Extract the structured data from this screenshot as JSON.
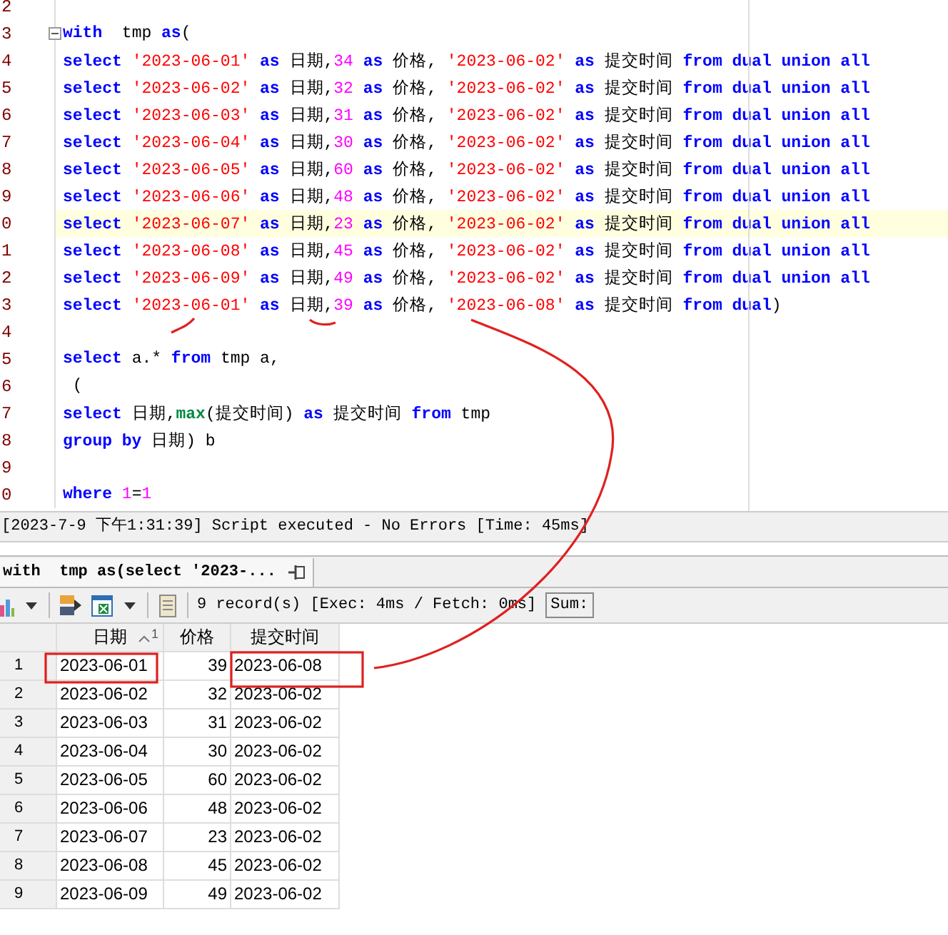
{
  "editor": {
    "lines": [
      {
        "number": "2",
        "current": false,
        "fold": false
      },
      {
        "number": "3",
        "current": false,
        "fold": true,
        "tokens": [
          {
            "kind": "kw",
            "text": "with"
          },
          {
            "kind": "t",
            "text": "  tmp "
          },
          {
            "kind": "kw",
            "text": "as"
          },
          {
            "kind": "t",
            "text": "("
          }
        ]
      },
      {
        "number": "4",
        "current": false,
        "fold": false,
        "tokens": [
          {
            "kind": "kw",
            "text": "select "
          },
          {
            "kind": "str",
            "text": "'2023-06-01' "
          },
          {
            "kind": "kw",
            "text": "as "
          },
          {
            "kind": "t",
            "text": "日期,"
          },
          {
            "kind": "num",
            "text": "34 "
          },
          {
            "kind": "kw",
            "text": "as "
          },
          {
            "kind": "t",
            "text": "价格, "
          },
          {
            "kind": "str",
            "text": "'2023-06-02' "
          },
          {
            "kind": "kw",
            "text": "as "
          },
          {
            "kind": "t",
            "text": "提交时间 "
          },
          {
            "kind": "kw",
            "text": "from dual union all"
          }
        ]
      },
      {
        "number": "5",
        "current": false,
        "fold": false,
        "tokens": [
          {
            "kind": "kw",
            "text": "select "
          },
          {
            "kind": "str",
            "text": "'2023-06-02' "
          },
          {
            "kind": "kw",
            "text": "as "
          },
          {
            "kind": "t",
            "text": "日期,"
          },
          {
            "kind": "num",
            "text": "32 "
          },
          {
            "kind": "kw",
            "text": "as "
          },
          {
            "kind": "t",
            "text": "价格, "
          },
          {
            "kind": "str",
            "text": "'2023-06-02' "
          },
          {
            "kind": "kw",
            "text": "as "
          },
          {
            "kind": "t",
            "text": "提交时间 "
          },
          {
            "kind": "kw",
            "text": "from dual union all"
          }
        ]
      },
      {
        "number": "6",
        "current": false,
        "fold": false,
        "tokens": [
          {
            "kind": "kw",
            "text": "select "
          },
          {
            "kind": "str",
            "text": "'2023-06-03' "
          },
          {
            "kind": "kw",
            "text": "as "
          },
          {
            "kind": "t",
            "text": "日期,"
          },
          {
            "kind": "num",
            "text": "31 "
          },
          {
            "kind": "kw",
            "text": "as "
          },
          {
            "kind": "t",
            "text": "价格, "
          },
          {
            "kind": "str",
            "text": "'2023-06-02' "
          },
          {
            "kind": "kw",
            "text": "as "
          },
          {
            "kind": "t",
            "text": "提交时间 "
          },
          {
            "kind": "kw",
            "text": "from dual union all"
          }
        ]
      },
      {
        "number": "7",
        "current": false,
        "fold": false,
        "tokens": [
          {
            "kind": "kw",
            "text": "select "
          },
          {
            "kind": "str",
            "text": "'2023-06-04' "
          },
          {
            "kind": "kw",
            "text": "as "
          },
          {
            "kind": "t",
            "text": "日期,"
          },
          {
            "kind": "num",
            "text": "30 "
          },
          {
            "kind": "kw",
            "text": "as "
          },
          {
            "kind": "t",
            "text": "价格, "
          },
          {
            "kind": "str",
            "text": "'2023-06-02' "
          },
          {
            "kind": "kw",
            "text": "as "
          },
          {
            "kind": "t",
            "text": "提交时间 "
          },
          {
            "kind": "kw",
            "text": "from dual union all"
          }
        ]
      },
      {
        "number": "8",
        "current": false,
        "fold": false,
        "tokens": [
          {
            "kind": "kw",
            "text": "select "
          },
          {
            "kind": "str",
            "text": "'2023-06-05' "
          },
          {
            "kind": "kw",
            "text": "as "
          },
          {
            "kind": "t",
            "text": "日期,"
          },
          {
            "kind": "num",
            "text": "60 "
          },
          {
            "kind": "kw",
            "text": "as "
          },
          {
            "kind": "t",
            "text": "价格, "
          },
          {
            "kind": "str",
            "text": "'2023-06-02' "
          },
          {
            "kind": "kw",
            "text": "as "
          },
          {
            "kind": "t",
            "text": "提交时间 "
          },
          {
            "kind": "kw",
            "text": "from dual union all"
          }
        ]
      },
      {
        "number": "9",
        "current": false,
        "fold": false,
        "tokens": [
          {
            "kind": "kw",
            "text": "select "
          },
          {
            "kind": "str",
            "text": "'2023-06-06' "
          },
          {
            "kind": "kw",
            "text": "as "
          },
          {
            "kind": "t",
            "text": "日期,"
          },
          {
            "kind": "num",
            "text": "48 "
          },
          {
            "kind": "kw",
            "text": "as "
          },
          {
            "kind": "t",
            "text": "价格, "
          },
          {
            "kind": "str",
            "text": "'2023-06-02' "
          },
          {
            "kind": "kw",
            "text": "as "
          },
          {
            "kind": "t",
            "text": "提交时间 "
          },
          {
            "kind": "kw",
            "text": "from dual union all"
          }
        ]
      },
      {
        "number": "0",
        "current": true,
        "fold": false,
        "tokens": [
          {
            "kind": "kw",
            "text": "select "
          },
          {
            "kind": "str",
            "text": "'2023-06-07' "
          },
          {
            "kind": "kw",
            "text": "as "
          },
          {
            "kind": "t",
            "text": "日期,"
          },
          {
            "kind": "num",
            "text": "23 "
          },
          {
            "kind": "kw",
            "text": "as "
          },
          {
            "kind": "t",
            "text": "价格, "
          },
          {
            "kind": "str",
            "text": "'2023-06-02' "
          },
          {
            "kind": "kw",
            "text": "as "
          },
          {
            "kind": "t",
            "text": "提交时间 "
          },
          {
            "kind": "kw",
            "text": "from dual union all"
          }
        ]
      },
      {
        "number": "1",
        "current": false,
        "fold": false,
        "tokens": [
          {
            "kind": "kw",
            "text": "select "
          },
          {
            "kind": "str",
            "text": "'2023-06-08' "
          },
          {
            "kind": "kw",
            "text": "as "
          },
          {
            "kind": "t",
            "text": "日期,"
          },
          {
            "kind": "num",
            "text": "45 "
          },
          {
            "kind": "kw",
            "text": "as "
          },
          {
            "kind": "t",
            "text": "价格, "
          },
          {
            "kind": "str",
            "text": "'2023-06-02' "
          },
          {
            "kind": "kw",
            "text": "as "
          },
          {
            "kind": "t",
            "text": "提交时间 "
          },
          {
            "kind": "kw",
            "text": "from dual union all"
          }
        ]
      },
      {
        "number": "2",
        "current": false,
        "fold": false,
        "tokens": [
          {
            "kind": "kw",
            "text": "select "
          },
          {
            "kind": "str",
            "text": "'2023-06-09' "
          },
          {
            "kind": "kw",
            "text": "as "
          },
          {
            "kind": "t",
            "text": "日期,"
          },
          {
            "kind": "num",
            "text": "49 "
          },
          {
            "kind": "kw",
            "text": "as "
          },
          {
            "kind": "t",
            "text": "价格, "
          },
          {
            "kind": "str",
            "text": "'2023-06-02' "
          },
          {
            "kind": "kw",
            "text": "as "
          },
          {
            "kind": "t",
            "text": "提交时间 "
          },
          {
            "kind": "kw",
            "text": "from dual union all"
          }
        ]
      },
      {
        "number": "3",
        "current": false,
        "fold": false,
        "tokens": [
          {
            "kind": "kw",
            "text": "select "
          },
          {
            "kind": "str",
            "text": "'2023-06-01' "
          },
          {
            "kind": "kw",
            "text": "as "
          },
          {
            "kind": "t",
            "text": "日期,"
          },
          {
            "kind": "num",
            "text": "39 "
          },
          {
            "kind": "kw",
            "text": "as "
          },
          {
            "kind": "t",
            "text": "价格, "
          },
          {
            "kind": "str",
            "text": "'2023-06-08' "
          },
          {
            "kind": "kw",
            "text": "as "
          },
          {
            "kind": "t",
            "text": "提交时间 "
          },
          {
            "kind": "kw",
            "text": "from dual"
          },
          {
            "kind": "t",
            "text": ")"
          }
        ]
      },
      {
        "number": "4",
        "current": false,
        "fold": false
      },
      {
        "number": "5",
        "current": false,
        "fold": false,
        "tokens": [
          {
            "kind": "kw",
            "text": "select "
          },
          {
            "kind": "t",
            "text": "a.* "
          },
          {
            "kind": "kw",
            "text": "from "
          },
          {
            "kind": "t",
            "text": "tmp a,"
          }
        ]
      },
      {
        "number": "6",
        "current": false,
        "fold": false,
        "tokens": [
          {
            "kind": "t",
            "text": " ("
          }
        ]
      },
      {
        "number": "7",
        "current": false,
        "fold": false,
        "tokens": [
          {
            "kind": "kw",
            "text": "select "
          },
          {
            "kind": "t",
            "text": "日期,"
          },
          {
            "kind": "fn",
            "text": "max"
          },
          {
            "kind": "t",
            "text": "(提交时间) "
          },
          {
            "kind": "kw",
            "text": "as "
          },
          {
            "kind": "t",
            "text": "提交时间 "
          },
          {
            "kind": "kw",
            "text": "from "
          },
          {
            "kind": "t",
            "text": "tmp"
          }
        ]
      },
      {
        "number": "8",
        "current": false,
        "fold": false,
        "tokens": [
          {
            "kind": "kw",
            "text": "group by "
          },
          {
            "kind": "t",
            "text": "日期) b"
          }
        ]
      },
      {
        "number": "9",
        "current": false,
        "fold": false
      },
      {
        "number": "0",
        "current": false,
        "fold": false,
        "tokens": [
          {
            "kind": "kw",
            "text": "where "
          },
          {
            "kind": "num",
            "text": "1"
          },
          {
            "kind": "t",
            "text": "="
          },
          {
            "kind": "num",
            "text": "1"
          }
        ]
      }
    ]
  },
  "status_line": "[2023-7-9 下午1:31:39] Script executed - No Errors [Time: 45ms]",
  "result_tab": {
    "label": "with  tmp as(select '2023-..."
  },
  "toolbar": {
    "summary": "9 record(s) [Exec: 4ms / Fetch: 0ms]",
    "sum_label": "Sum:"
  },
  "grid": {
    "columns": [
      {
        "label": "日期",
        "sort_order": "1",
        "kind": "text"
      },
      {
        "label": "价格",
        "kind": "number"
      },
      {
        "label": "提交时间",
        "kind": "text"
      }
    ],
    "rows": [
      {
        "number": "1",
        "cells": [
          "2023-06-01",
          "39",
          "2023-06-08"
        ]
      },
      {
        "number": "2",
        "cells": [
          "2023-06-02",
          "32",
          "2023-06-02"
        ]
      },
      {
        "number": "3",
        "cells": [
          "2023-06-03",
          "31",
          "2023-06-02"
        ]
      },
      {
        "number": "4",
        "cells": [
          "2023-06-04",
          "30",
          "2023-06-02"
        ]
      },
      {
        "number": "5",
        "cells": [
          "2023-06-05",
          "60",
          "2023-06-02"
        ]
      },
      {
        "number": "6",
        "cells": [
          "2023-06-06",
          "48",
          "2023-06-02"
        ]
      },
      {
        "number": "7",
        "cells": [
          "2023-06-07",
          "23",
          "2023-06-02"
        ]
      },
      {
        "number": "8",
        "cells": [
          "2023-06-08",
          "45",
          "2023-06-02"
        ]
      },
      {
        "number": "9",
        "cells": [
          "2023-06-09",
          "49",
          "2023-06-02"
        ]
      }
    ]
  }
}
